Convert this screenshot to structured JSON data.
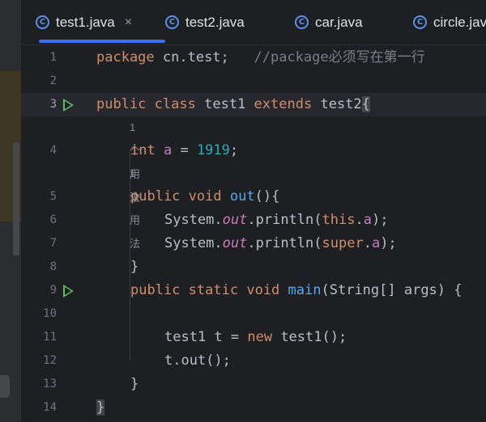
{
  "tabs": [
    {
      "label": "test1.java",
      "icon": "class-icon",
      "active": true
    },
    {
      "label": "test2.java",
      "icon": "class-icon"
    },
    {
      "label": "car.java",
      "icon": "class-icon"
    },
    {
      "label": "circle.java",
      "icon": "class-icon"
    }
  ],
  "icon_glyph": "C",
  "close_glyph": "×",
  "line_numbers": [
    "1",
    "2",
    "3",
    "4",
    "5",
    "6",
    "7",
    "8",
    "9",
    "10",
    "11",
    "12",
    "13",
    "14"
  ],
  "hints": {
    "usage": "1 个用法"
  },
  "code": {
    "l1": {
      "kw": "package",
      "rest": " cn.test;   ",
      "comment": "//package必须写在第一行"
    },
    "l3": {
      "kw1": "public",
      "kw2": "class",
      "name": "test1",
      "kw3": "extends",
      "parent": "test2",
      "brace": "{"
    },
    "l4": {
      "kw": "int",
      "field": "a",
      "eq": " = ",
      "num": "1919",
      "end": ";"
    },
    "l5": {
      "kw1": "public",
      "kw2": "void",
      "fn": "out",
      "end": "(){"
    },
    "l6": {
      "pre": "System.",
      "st": "out",
      "mid": ".println(",
      "kw": "this",
      "dot": ".",
      "field": "a",
      "end": ");"
    },
    "l7": {
      "pre": "System.",
      "st": "out",
      "mid": ".println(",
      "kw": "super",
      "dot": ".",
      "field": "a",
      "end": ");"
    },
    "l8": {
      "text": "}"
    },
    "l9": {
      "kw1": "public",
      "kw2": "static",
      "kw3": "void",
      "fn": "main",
      "end": "(String[] args) {"
    },
    "l11": {
      "pre": "test1 t = ",
      "kw": "new",
      "end": " test1();"
    },
    "l12": {
      "text": "t.out();"
    },
    "l13": {
      "text": "}"
    },
    "l14": {
      "text": "}"
    }
  }
}
